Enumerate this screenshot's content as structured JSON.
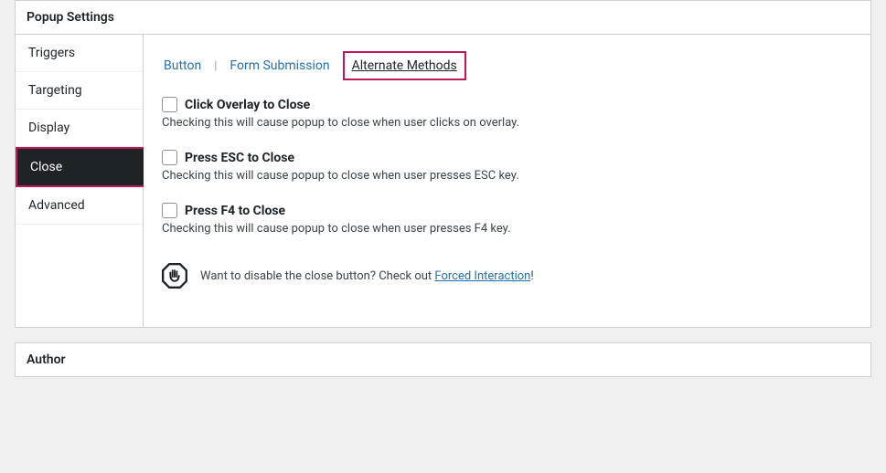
{
  "panel_title": "Popup Settings",
  "sidebar": [
    "Triggers",
    "Targeting",
    "Display",
    "Close",
    "Advanced"
  ],
  "sidebar_active": 3,
  "tabs": [
    "Button",
    "Form Submission",
    "Alternate Methods"
  ],
  "tabs_active": 2,
  "options": [
    {
      "title": "Click Overlay to Close",
      "desc": "Checking this will cause popup to close when user clicks on overlay."
    },
    {
      "title": "Press ESC to Close",
      "desc": "Checking this will cause popup to close when user presses ESC key."
    },
    {
      "title": "Press F4 to Close",
      "desc": "Checking this will cause popup to close when user presses F4 key."
    }
  ],
  "info": {
    "pre": "Want to disable the close button? Check out ",
    "link": "Forced Interaction",
    "post": "!"
  },
  "author_title": "Author"
}
